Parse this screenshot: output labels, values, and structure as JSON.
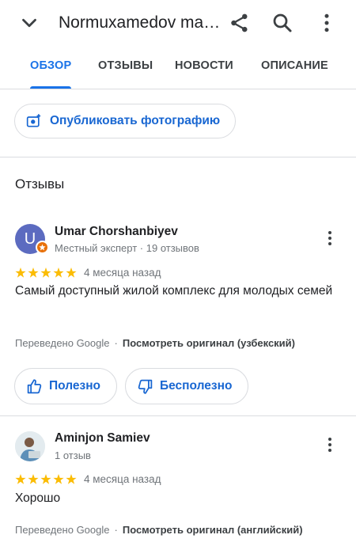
{
  "appbar": {
    "title": "Normuxamedov ma…",
    "back_icon": "arrow-back-icon",
    "share_icon": "share-icon",
    "search_icon": "search-icon",
    "menu_icon": "more-vert-icon"
  },
  "tabs": [
    {
      "label": "ОБЗОР",
      "active": true
    },
    {
      "label": "ОТЗЫВЫ",
      "active": false
    },
    {
      "label": "НОВОСТИ",
      "active": false
    },
    {
      "label": "ОПИСАНИЕ",
      "active": false
    }
  ],
  "photo_button": {
    "label": "Опубликовать фотографию",
    "icon": "add-photo-icon"
  },
  "reviews_section": {
    "title": "Отзывы"
  },
  "reviews": [
    {
      "avatar_letter": "U",
      "name": "Umar Chorshanbiyev",
      "meta": "Местный эксперт · 19 отзывов",
      "rating": 5,
      "date": "4 месяца назад",
      "text": "Самый доступный жилой комплекс для молодых семей",
      "translated_by": "Переведено Google",
      "original_link": "Посмотреть оригинал (узбекский)"
    },
    {
      "name": "Aminjon Samiev",
      "meta": "1 отзыв",
      "rating": 5,
      "date": "4 месяца назад",
      "text": "Хорошо",
      "translated_by": "Переведено Google",
      "original_link": "Посмотреть оригинал (английский)"
    }
  ],
  "feedback": {
    "helpful": "Полезно",
    "not_helpful": "Бесполезно"
  },
  "colors": {
    "accent": "#1a73e8",
    "star": "#fbbc04",
    "badge": "#e8710a",
    "avatar": "#5c6bc0"
  }
}
